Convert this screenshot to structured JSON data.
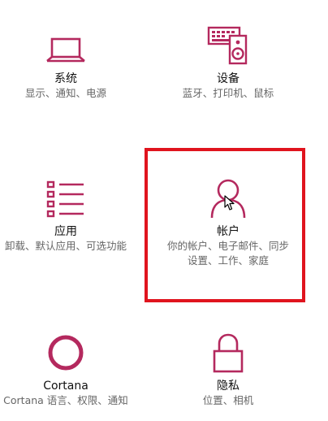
{
  "accent_color": "#b4295e",
  "highlight_color": "#e0141e",
  "tiles": [
    {
      "title": "系统",
      "desc": [
        "显示、通知、电源"
      ],
      "icon": "laptop-icon"
    },
    {
      "title": "设备",
      "desc": [
        "蓝牙、打印机、鼠标"
      ],
      "icon": "keyboard-speaker-icon"
    },
    {
      "title": "应用",
      "desc": [
        "卸载、默认应用、可选功能"
      ],
      "icon": "list-icon"
    },
    {
      "title": "帐户",
      "desc": [
        "你的帐户、电子邮件、同步",
        "设置、工作、家庭"
      ],
      "icon": "person-icon"
    },
    {
      "title": "Cortana",
      "desc": [
        "Cortana 语言、权限、通知"
      ],
      "icon": "circle-icon"
    },
    {
      "title": "隐私",
      "desc": [
        "位置、相机"
      ],
      "icon": "lock-icon"
    }
  ]
}
